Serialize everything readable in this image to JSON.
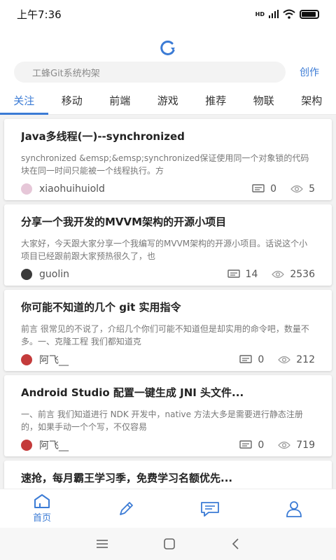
{
  "status": {
    "time": "上午7:36",
    "signal": "HD"
  },
  "search": {
    "placeholder": "工蜂Git系统构架"
  },
  "header": {
    "create_label": "创作"
  },
  "tabs": [
    "关注",
    "移动",
    "前端",
    "游戏",
    "推荐",
    "物联",
    "架构"
  ],
  "articles": [
    {
      "title": "Java多线程(一)--synchronized",
      "summary": "synchronized &emsp;&emsp;synchronized保证使用同一个对象锁的代码块在同一时间只能被一个线程执行。方",
      "author": "xiaohuihuiold",
      "comments": "0",
      "views": "5"
    },
    {
      "title": "分享一个我开发的MVVM架构的开源小项目",
      "summary": "大家好，今天跟大家分享一个我编写的MVVM架构的开源小项目。话说这个小项目已经跟前跟大家预热很久了，也",
      "author": "guolin",
      "comments": "14",
      "views": "2536"
    },
    {
      "title": "你可能不知道的几个 git 实用指令",
      "summary": "前言 很常见的不说了，介绍几个你们可能不知道但是却实用的命令吧，数量不多。一、克隆工程 我们都知道克",
      "author": "阿飞__",
      "comments": "0",
      "views": "212"
    },
    {
      "title": "Android Studio 配置一键生成 JNI 头文件...",
      "summary": "一、前言 我们知道进行 NDK 开发中，native 方法大多是需要进行静态注册的，如果手动一个个写，不仅容易",
      "author": "阿飞__",
      "comments": "0",
      "views": "719"
    },
    {
      "title": "速抢，每月霸王学习季，免费学习名额优先...",
      "summary": "",
      "author": "",
      "comments": "",
      "views": ""
    }
  ],
  "bottom_nav": {
    "home_label": "首页"
  },
  "colors": {
    "accent": "#3b7bd5"
  }
}
